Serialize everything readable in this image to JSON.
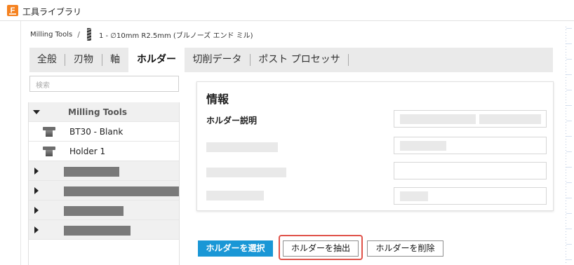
{
  "window": {
    "title": "工具ライブラリ",
    "app_icon_letter": "F"
  },
  "breadcrumb": {
    "root": "Milling Tools",
    "separator": "/",
    "tool": "1 - ∅10mm R2.5mm (ブルノーズ エンド ミル)"
  },
  "tabs": [
    {
      "label": "全般",
      "active": false
    },
    {
      "label": "刃物",
      "active": false
    },
    {
      "label": "軸",
      "active": false
    },
    {
      "label": "ホルダー",
      "active": true
    },
    {
      "label": "切削データ",
      "active": false
    },
    {
      "label": "ポスト プロセッサ",
      "active": false
    }
  ],
  "search": {
    "placeholder": "検索"
  },
  "tree": {
    "group_label": "Milling Tools",
    "items": [
      {
        "label": "BT30 - Blank",
        "icon": "holder-icon"
      },
      {
        "label": "Holder  1",
        "icon": "holder-icon"
      }
    ],
    "collapsed_groups_count": 4
  },
  "info": {
    "title": "情報",
    "holder_description_label": "ホルダー説明"
  },
  "buttons": {
    "select": "ホルダーを選択",
    "extract": "ホルダーを抽出",
    "delete": "ホルダーを削除"
  },
  "colors": {
    "accent": "#1a97d6",
    "highlight": "#e0534a",
    "app_icon": "#f58220"
  }
}
